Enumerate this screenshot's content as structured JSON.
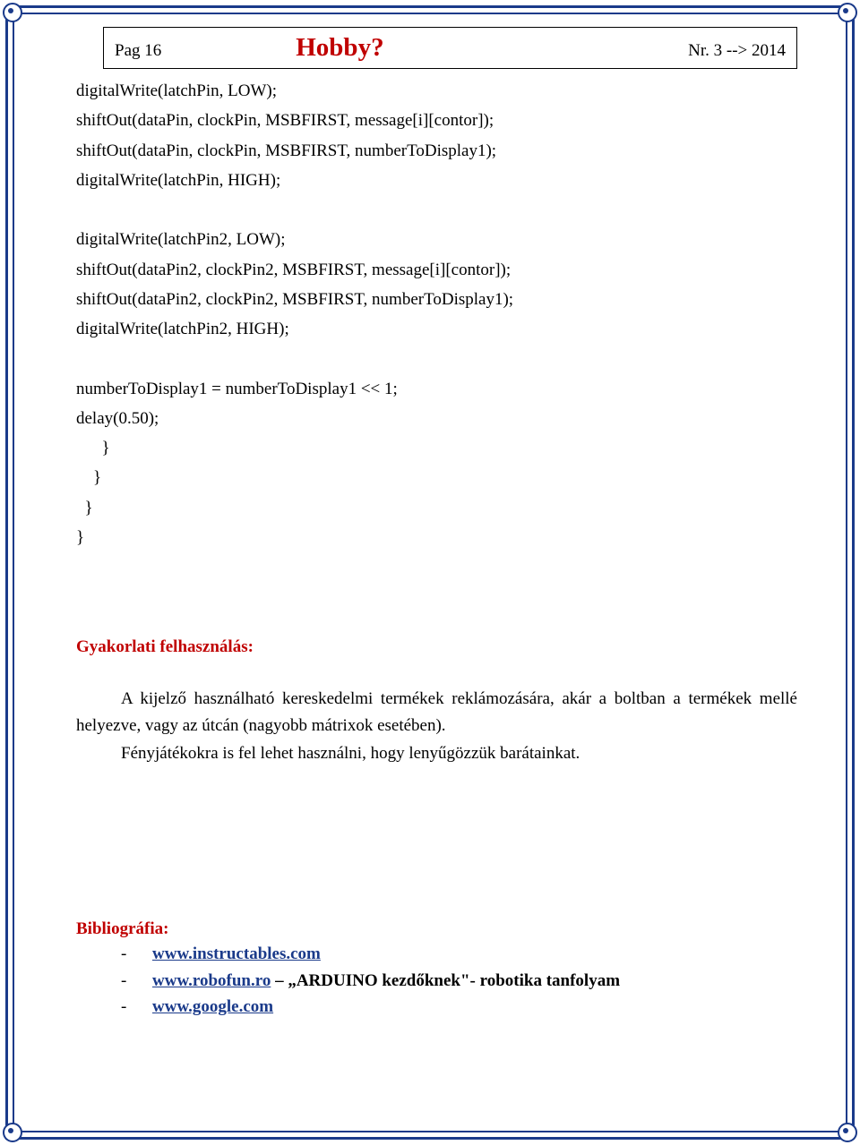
{
  "header": {
    "page_left": "Pag  16",
    "title": "Hobby?",
    "page_right": "Nr. 3  --> 2014"
  },
  "code": {
    "l1": "digitalWrite(latchPin, LOW);",
    "l2": "shiftOut(dataPin, clockPin, MSBFIRST, message[i][contor]);",
    "l3": "shiftOut(dataPin, clockPin, MSBFIRST, numberToDisplay1);",
    "l4": "digitalWrite(latchPin, HIGH);",
    "l5": "digitalWrite(latchPin2, LOW);",
    "l6": "shiftOut(dataPin2, clockPin2, MSBFIRST, message[i][contor]);",
    "l7": "shiftOut(dataPin2, clockPin2, MSBFIRST, numberToDisplay1);",
    "l8": "digitalWrite(latchPin2, HIGH);",
    "l9": "numberToDisplay1 = numberToDisplay1 << 1;",
    "l10": "delay(0.50);",
    "b1": "}",
    "b2": "}",
    "b3": "}",
    "b4": "}"
  },
  "section": {
    "title": "Gyakorlati felhasználás:",
    "p1": "A kijelző használható kereskedelmi termékek reklámozására, akár a boltban a termékek mellé helyezve, vagy az útcán (nagyobb mátrixok esetében).",
    "p2": "Fényjátékokra is fel lehet használni, hogy lenyűgözzük barátainkat."
  },
  "biblio": {
    "title": "Bibliográfia:",
    "items": [
      {
        "link": "www.instructables.com",
        "rest": ""
      },
      {
        "link": "www.robofun.ro",
        "rest": " – „ARDUINO kezdőknek\"- robotika tanfolyam"
      },
      {
        "link": "www.google.com",
        "rest": ""
      }
    ]
  }
}
